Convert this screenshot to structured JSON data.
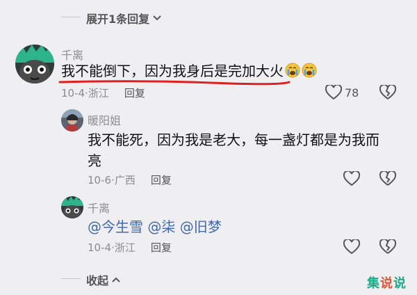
{
  "expand_replies": {
    "label": "展开1条回复"
  },
  "comments": [
    {
      "author": "千离",
      "text": "我不能倒下，因为我身后是完加大火",
      "emojis": [
        "crying-face",
        "crying-face"
      ],
      "date": "10-4",
      "location": "浙江",
      "reply_label": "回复",
      "likes": "78"
    },
    {
      "author": "暖阳姐",
      "text_line1": "我不能死，因为我是老大，每一盏灯都是为我而",
      "text_line2": "亮",
      "date": "10-6",
      "location": "广西",
      "reply_label": "回复"
    },
    {
      "author": "千离",
      "mentions": [
        "@今生雪",
        "@柒",
        "@旧梦"
      ],
      "date": "10-4",
      "location": "浙江",
      "reply_label": "回复"
    }
  ],
  "collapse": {
    "label": "收起"
  },
  "watermark": {
    "part1": "集",
    "part2": "说",
    "part3": "说"
  },
  "colors": {
    "underline": "#e02020",
    "mention": "#3f69a8",
    "accent": "#22a98a"
  }
}
